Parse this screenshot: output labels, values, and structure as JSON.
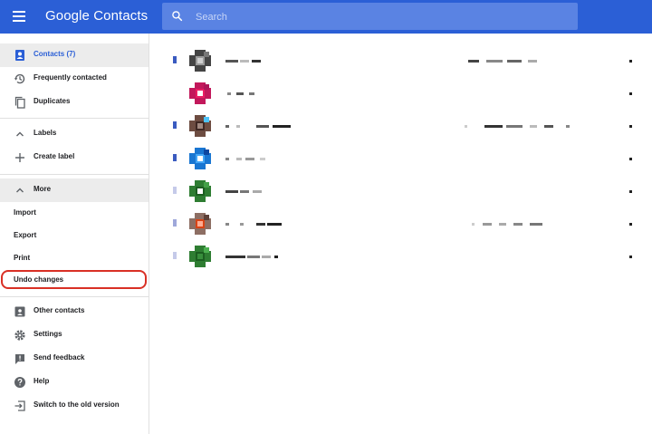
{
  "topbar": {
    "brand": "Google Contacts",
    "search_placeholder": "Search",
    "color": "#2b5fd6"
  },
  "sidebar": {
    "main": [
      {
        "label": "Contacts (7)",
        "icon": "contacts-icon",
        "active": true
      },
      {
        "label": "Frequently contacted",
        "icon": "history-icon"
      },
      {
        "label": "Duplicates",
        "icon": "copy-icon"
      }
    ],
    "labels_header": "Labels",
    "create_label": "Create label",
    "more_header": "More",
    "more_items": [
      "Import",
      "Export",
      "Print",
      "Undo changes"
    ],
    "footer": [
      {
        "label": "Other contacts",
        "icon": "other-contacts-icon"
      },
      {
        "label": "Settings",
        "icon": "gear-icon"
      },
      {
        "label": "Send feedback",
        "icon": "feedback-icon"
      },
      {
        "label": "Help",
        "icon": "help-icon"
      },
      {
        "label": "Switch to the old version",
        "icon": "exit-icon"
      }
    ],
    "highlight_color": "#d93025"
  },
  "contacts": [
    {
      "avatar_colors": [
        "#444444",
        "#9a9a9a",
        "#cfcfcf",
        "#777777"
      ],
      "selector_color": "#3a5bc0"
    },
    {
      "avatar_colors": [
        "#c2185b",
        "#e91e63",
        "#ffffff",
        "#ad1457"
      ],
      "selector_color": ""
    },
    {
      "avatar_colors": [
        "#6d4c41",
        "#3e2723",
        "#a1887f",
        "#4fc3f7"
      ],
      "selector_color": "#3a5bc0"
    },
    {
      "avatar_colors": [
        "#1976d2",
        "#42a5f5",
        "#ffffff",
        "#0d47a1"
      ],
      "selector_color": "#3a5bc0"
    },
    {
      "avatar_colors": [
        "#2e7d32",
        "#1b5e20",
        "#ffffff",
        "#43a047"
      ],
      "selector_color": "#c5cae9"
    },
    {
      "avatar_colors": [
        "#8d6e63",
        "#d84315",
        "#ffab91",
        "#5d4037"
      ],
      "selector_color": "#9fa8da"
    },
    {
      "avatar_colors": [
        "#2e7d32",
        "#1b5e20",
        "#388e3c",
        "#4caf50"
      ],
      "selector_color": "#c5cae9"
    }
  ]
}
